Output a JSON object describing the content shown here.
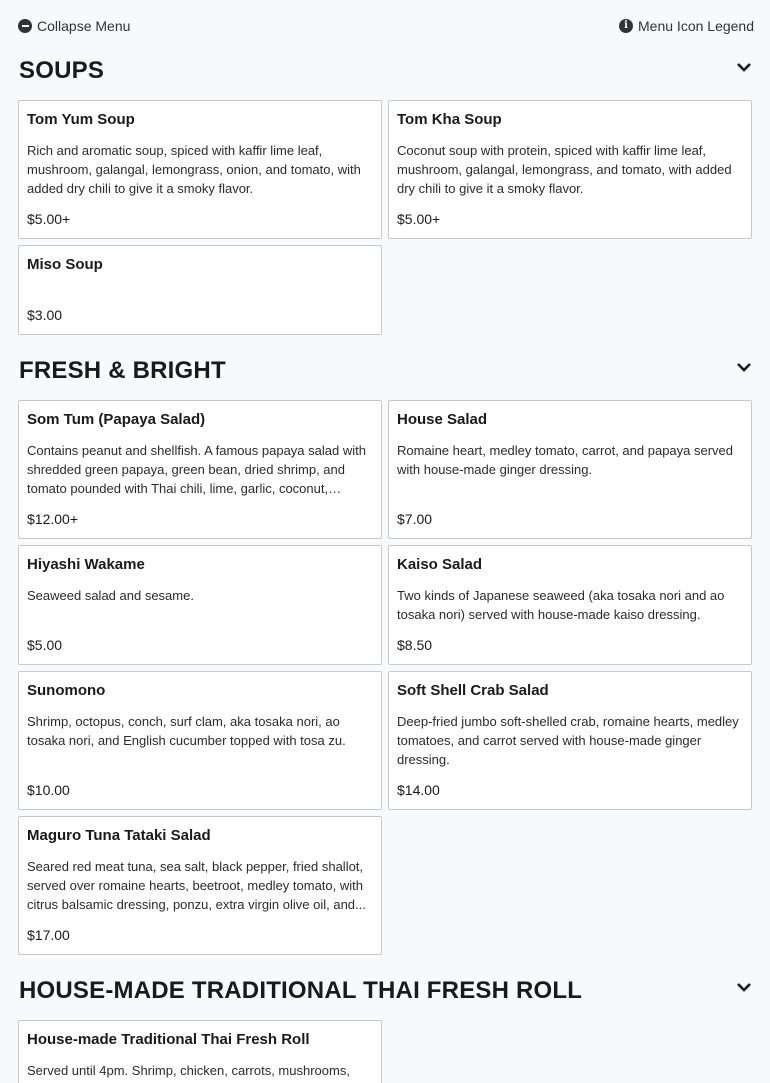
{
  "topbar": {
    "collapse_label": "Collapse Menu",
    "legend_label": "Menu Icon Legend"
  },
  "sections": [
    {
      "title": "SOUPS",
      "items": [
        {
          "name": "Tom Yum Soup",
          "description": "Rich and aromatic soup, spiced with kaffir lime leaf, mushroom, galangal, lemongrass, onion, and tomato, with added dry chili to give it a smoky flavor.",
          "price": "$5.00+"
        },
        {
          "name": "Tom Kha Soup",
          "description": "Coconut soup with protein, spiced with kaffir lime leaf, mushroom, galangal, lemongrass, and tomato, with added dry chili to give it a smoky flavor.",
          "price": "$5.00+"
        },
        {
          "name": "Miso Soup",
          "description": "",
          "price": "$3.00"
        }
      ]
    },
    {
      "title": "FRESH & BRIGHT",
      "items": [
        {
          "name": "Som Tum (Papaya Salad)",
          "description": "Contains peanut and shellfish. A famous papaya salad with shredded green papaya, green bean, dried shrimp, and tomato pounded with Thai chili, lime, garlic, coconut, sugar,...",
          "price": "$12.00+"
        },
        {
          "name": "House Salad",
          "description": "Romaine heart, medley tomato, carrot, and papaya served with house-made ginger dressing.",
          "price": "$7.00"
        },
        {
          "name": "Hiyashi Wakame",
          "description": "Seaweed salad and sesame.",
          "price": "$5.00"
        },
        {
          "name": "Kaiso Salad",
          "description": "Two kinds of Japanese seaweed (aka tosaka nori and ao tosaka nori) served with house-made kaiso dressing.",
          "price": "$8.50"
        },
        {
          "name": "Sunomono",
          "description": "Shrimp, octopus, conch, surf clam, aka tosaka nori, ao tosaka nori, and English cucumber topped with tosa zu.",
          "price": "$10.00"
        },
        {
          "name": "Soft Shell Crab Salad",
          "description": "Deep-fried jumbo soft-shelled crab, romaine hearts, medley tomatoes, and carrot served with house-made ginger dressing.",
          "price": "$14.00"
        },
        {
          "name": "Maguro Tuna Tataki Salad",
          "description": "Seared red meat tuna, sea salt, black pepper, fried shallot, served over romaine hearts, beetroot, medley tomato, with citrus balsamic dressing, ponzu, extra virgin olive oil, and...",
          "price": "$17.00"
        }
      ]
    },
    {
      "title": "HOUSE-MADE TRADITIONAL THAI FRESH ROLL",
      "items": [
        {
          "name": "House-made Traditional Thai Fresh Roll",
          "description": "Served until 4pm. Shrimp, chicken, carrots, mushrooms,",
          "price": ""
        }
      ]
    }
  ]
}
